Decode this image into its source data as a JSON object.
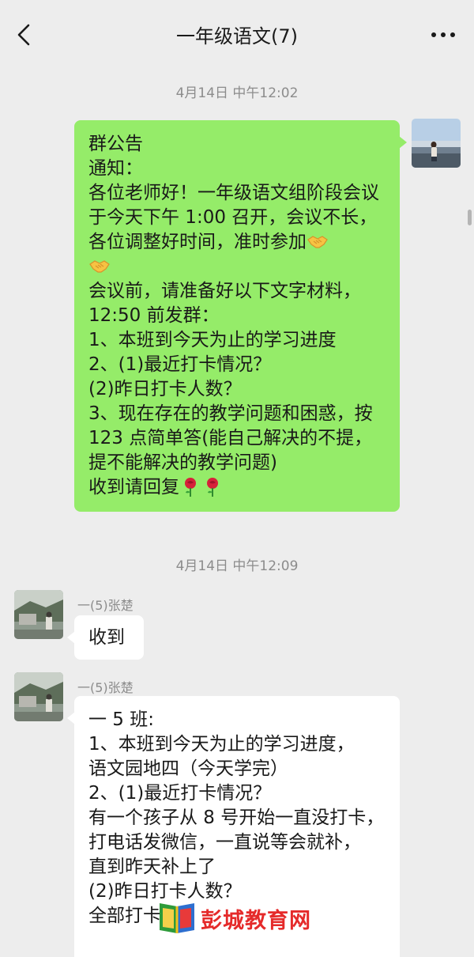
{
  "header": {
    "title": "一年级语文(7)",
    "back_icon": "chevron-left-icon",
    "more_icon": "more-dots-icon"
  },
  "messages": [
    {
      "time": "4月14日 中午12:02",
      "side": "right",
      "lines_before_emoji": "群公告\n通知：\n各位老师好！一年级语文组阶段会议于今天下午 1:00 召开，会议不长，各位调整好时间，准时参加",
      "emoji_1": "handshake",
      "lines_after_emoji": "会议前，请准备好以下文字材料，\n12:50 前发群：\n1、本班到今天为止的学习进度\n2、(1)最近打卡情况？\n(2)昨日打卡人数？\n3、现在存在的教学问题和困惑，按 123 点简单答(能自己解决的不提，提不能解决的教学问题)\n收到请回复",
      "emoji_2": "rose"
    },
    {
      "time": "4月14日 中午12:09",
      "side": "left",
      "sender": "一(5)张楚",
      "text": "收到"
    },
    {
      "side": "left",
      "sender": "一(5)张楚",
      "text": "一 5 班:\n1、本班到今天为止的学习进度，\n语文园地四（今天学完）\n2、(1)最近打卡情况？\n有一个孩子从 8 号开始一直没打卡，\n打电话发微信，一直说等会就补，\n直到昨天补上了\n(2)昨日打卡人数？\n全部打卡"
    }
  ],
  "watermark": {
    "text": "彭城教育网"
  },
  "colors": {
    "background": "#ededed",
    "self_bubble": "#95ec69",
    "other_bubble": "#ffffff",
    "meta_text": "#8c8c8c"
  }
}
